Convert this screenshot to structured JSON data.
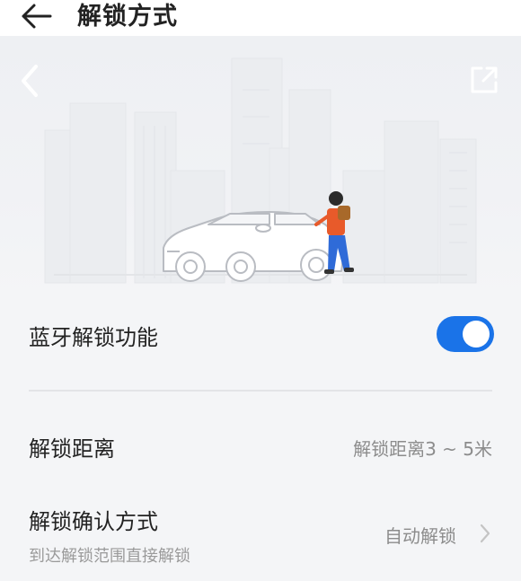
{
  "header": {
    "title": "解锁方式",
    "back_icon": "back-arrow-icon"
  },
  "hero": {
    "chevron_icon": "chevron-left-icon",
    "share_icon": "share-external-icon",
    "illustration": "car-and-person-city-illustration"
  },
  "settings": {
    "bluetooth": {
      "label": "蓝牙解锁功能",
      "enabled": true
    },
    "distance": {
      "label": "解锁距离",
      "value": "解锁距离3 ~ 5米"
    },
    "confirm": {
      "label": "解锁确认方式",
      "sublabel": "到达解锁范围直接解锁",
      "value": "自动解锁",
      "chevron_icon": "chevron-right-icon"
    }
  },
  "colors": {
    "accent": "#1a73e8",
    "background": "#f4f5f7",
    "text": "#222222",
    "secondary_text": "#8c8c8c"
  }
}
